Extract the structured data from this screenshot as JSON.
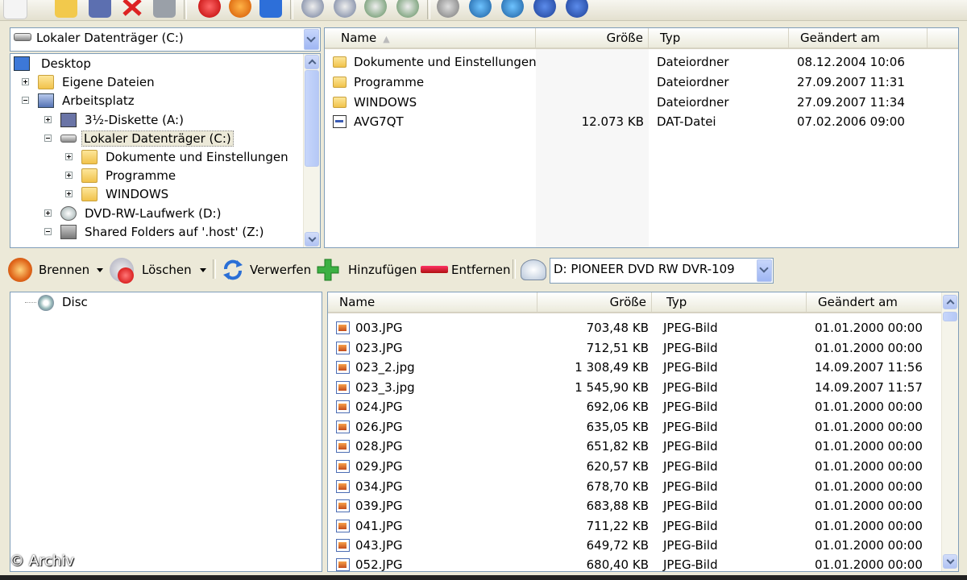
{
  "top_drive_combo": {
    "value": "Lokaler Datenträger (C:)"
  },
  "tree": {
    "items": [
      {
        "label": "Desktop"
      },
      {
        "label": "Eigene Dateien"
      },
      {
        "label": "Arbeitsplatz"
      },
      {
        "label": "3½-Diskette (A:)"
      },
      {
        "label": "Lokaler Datenträger (C:)"
      },
      {
        "label": "Dokumente und Einstellungen"
      },
      {
        "label": "Programme"
      },
      {
        "label": "WINDOWS"
      },
      {
        "label": "DVD-RW-Laufwerk (D:)"
      },
      {
        "label": "Shared Folders auf '.host' (Z:)"
      }
    ]
  },
  "top_list": {
    "columns": {
      "name": "Name",
      "size": "Größe",
      "type": "Typ",
      "modified": "Geändert am"
    },
    "rows": [
      {
        "name": "Dokumente und Einstellungen",
        "size": "",
        "type": "Dateiordner",
        "modified": "08.12.2004 10:06"
      },
      {
        "name": "Programme",
        "size": "",
        "type": "Dateiordner",
        "modified": "27.09.2007 11:31"
      },
      {
        "name": "WINDOWS",
        "size": "",
        "type": "Dateiordner",
        "modified": "27.09.2007 11:34"
      },
      {
        "name": "AVG7QT",
        "size": "12.073 KB",
        "type": "DAT-Datei",
        "modified": "07.02.2006 09:00"
      }
    ]
  },
  "burn_toolbar": {
    "brennen": "Brennen",
    "loeschen": "Löschen",
    "verwerfen": "Verwerfen",
    "hinzufuegen": "Hinzufügen",
    "entfernen": "Entfernen",
    "recorder": "D: PIONEER DVD RW  DVR-109"
  },
  "disc_tree": {
    "label": "Disc"
  },
  "bottom_list": {
    "columns": {
      "name": "Name",
      "size": "Größe",
      "type": "Typ",
      "modified": "Geändert am"
    },
    "rows": [
      {
        "name": "003.JPG",
        "size": "703,48 KB",
        "type": "JPEG-Bild",
        "modified": "01.01.2000 00:00"
      },
      {
        "name": "023.JPG",
        "size": "712,51 KB",
        "type": "JPEG-Bild",
        "modified": "01.01.2000 00:00"
      },
      {
        "name": "023_2.jpg",
        "size": "1 308,49 KB",
        "type": "JPEG-Bild",
        "modified": "14.09.2007 11:56"
      },
      {
        "name": "023_3.jpg",
        "size": "1 545,90 KB",
        "type": "JPEG-Bild",
        "modified": "14.09.2007 11:57"
      },
      {
        "name": "024.JPG",
        "size": "692,06 KB",
        "type": "JPEG-Bild",
        "modified": "01.01.2000 00:00"
      },
      {
        "name": "026.JPG",
        "size": "635,05 KB",
        "type": "JPEG-Bild",
        "modified": "01.01.2000 00:00"
      },
      {
        "name": "028.JPG",
        "size": "651,82 KB",
        "type": "JPEG-Bild",
        "modified": "01.01.2000 00:00"
      },
      {
        "name": "029.JPG",
        "size": "620,57 KB",
        "type": "JPEG-Bild",
        "modified": "01.01.2000 00:00"
      },
      {
        "name": "034.JPG",
        "size": "678,70 KB",
        "type": "JPEG-Bild",
        "modified": "01.01.2000 00:00"
      },
      {
        "name": "039.JPG",
        "size": "683,88 KB",
        "type": "JPEG-Bild",
        "modified": "01.01.2000 00:00"
      },
      {
        "name": "041.JPG",
        "size": "711,22 KB",
        "type": "JPEG-Bild",
        "modified": "01.01.2000 00:00"
      },
      {
        "name": "043.JPG",
        "size": "649,72 KB",
        "type": "JPEG-Bild",
        "modified": "01.01.2000 00:00"
      },
      {
        "name": "052.JPG",
        "size": "680,40 KB",
        "type": "JPEG-Bild",
        "modified": "01.01.2000 00:00"
      }
    ]
  },
  "watermark": "© Archiv"
}
